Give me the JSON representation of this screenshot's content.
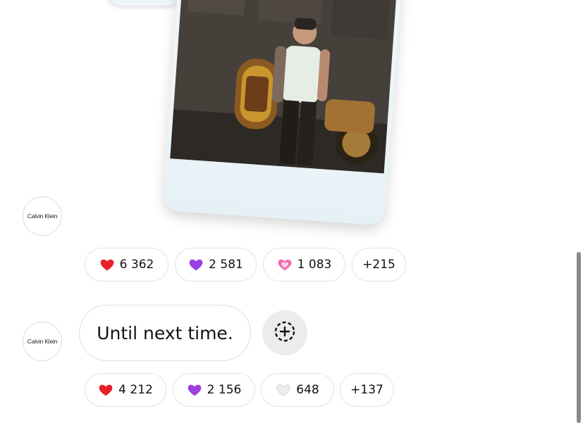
{
  "brand": {
    "avatar_label": "Calvin Klein"
  },
  "post_reactions": [
    {
      "icon": "red-heart-icon",
      "count": "6 362"
    },
    {
      "icon": "purple-heart-icon",
      "count": "2 581"
    },
    {
      "icon": "sparkling-heart-icon",
      "count": "1 083"
    },
    {
      "icon": "more",
      "count": "+215"
    }
  ],
  "message": {
    "text": "Until next time."
  },
  "message_reactions": [
    {
      "icon": "red-heart-icon",
      "count": "4 212"
    },
    {
      "icon": "purple-heart-icon",
      "count": "2 156"
    },
    {
      "icon": "white-heart-icon",
      "count": "648"
    },
    {
      "icon": "more",
      "count": "+137"
    }
  ],
  "colors": {
    "red_heart": "#e8202a",
    "purple_heart": "#9b3fe0",
    "pink_heart": "#f06ab0",
    "white_heart": "#e6e6e6"
  }
}
